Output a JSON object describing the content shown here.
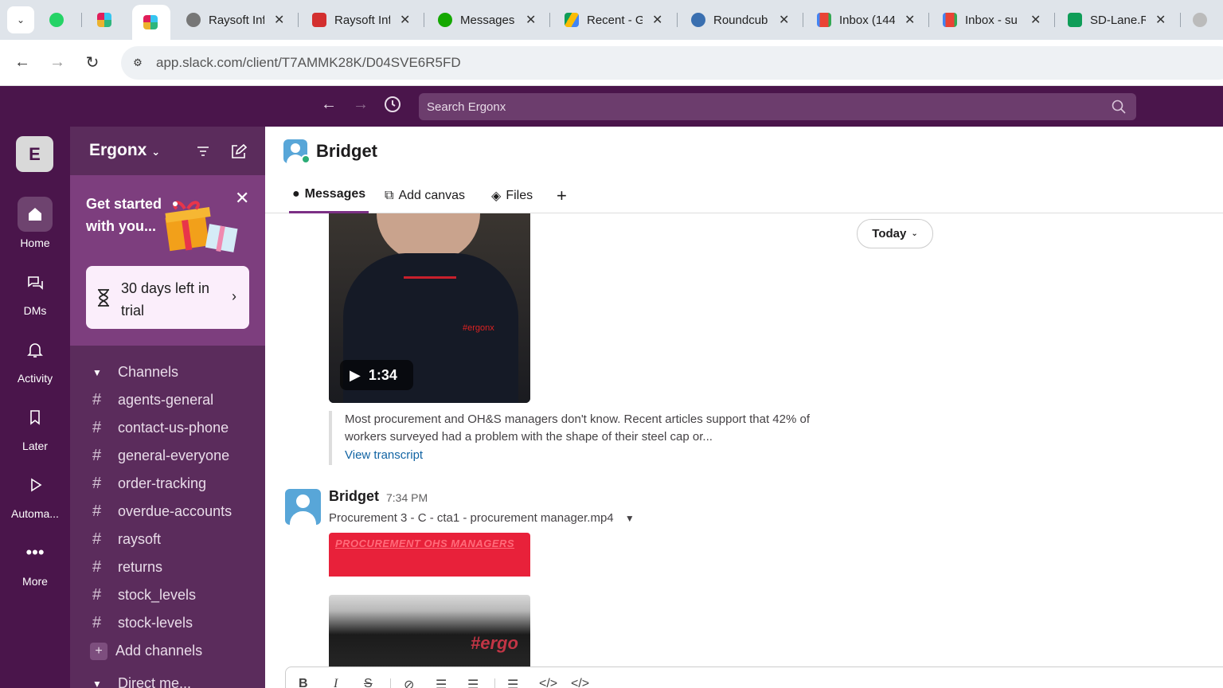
{
  "browser": {
    "tabs": [
      {
        "title": "",
        "color": "#25d366"
      },
      {
        "title": "",
        "color": "#e01e5a"
      },
      {
        "title": "",
        "color": "#e01e5a",
        "active": true
      },
      {
        "title": "Raysoft Inf",
        "color": "#777777"
      },
      {
        "title": "Raysoft Inf",
        "color": "#d32f2f"
      },
      {
        "title": "Messages",
        "color": "#14a800"
      },
      {
        "title": "Recent - G",
        "color": "#fbbc04"
      },
      {
        "title": "Roundcub",
        "color": "#3a6fb0"
      },
      {
        "title": "Inbox (144",
        "color": "#ea4335"
      },
      {
        "title": "Inbox - su",
        "color": "#ea4335"
      },
      {
        "title": "SD-Lane.R",
        "color": "#0f9d58"
      }
    ],
    "url": "app.slack.com/client/T7AMMK28K/D04SVE6R5FD"
  },
  "slack_top": {
    "search_placeholder": "Search Ergonx"
  },
  "rail": {
    "workspace_initial": "E",
    "items": [
      {
        "label": "Home",
        "icon": "home-icon"
      },
      {
        "label": "DMs",
        "icon": "dms-icon"
      },
      {
        "label": "Activity",
        "icon": "bell-icon"
      },
      {
        "label": "Later",
        "icon": "bookmark-icon"
      },
      {
        "label": "Automa...",
        "icon": "play-icon"
      },
      {
        "label": "More",
        "icon": "more-icon"
      }
    ]
  },
  "sidebar": {
    "workspace_name": "Ergonx",
    "promo_text": "Get started with you...",
    "trial_text": "30 days left in trial",
    "channels_label": "Channels",
    "channels": [
      "agents-general",
      "contact-us-phone",
      "general-everyone",
      "order-tracking",
      "overdue-accounts",
      "raysoft",
      "returns",
      "stock_levels",
      "stock-levels"
    ],
    "add_channels": "Add channels",
    "direct_messages": "Direct me..."
  },
  "channel": {
    "name": "Bridget",
    "tabs": [
      "Messages",
      "Add canvas",
      "Files"
    ]
  },
  "messages": {
    "video_duration": "1:34",
    "video_logo": "#ergonx",
    "today_label": "Today",
    "transcript_text": "Most procurement and OH&S managers don't know. Recent articles support that 42% of workers surveyed had a problem with the shape of their steel cap or...",
    "view_transcript": "View transcript",
    "msg2": {
      "author": "Bridget",
      "time": "7:34 PM",
      "file_name": "Procurement 3 - C - cta1 - procurement manager.mp4",
      "video_label": "PROCUREMENT OHS MANAGERS",
      "video3_label": "#ergo"
    }
  },
  "composer": {
    "format_buttons": [
      "B",
      "I",
      "S",
      "link",
      "ordered-list",
      "bullet-list",
      "blockquote",
      "code",
      "code-block"
    ]
  }
}
